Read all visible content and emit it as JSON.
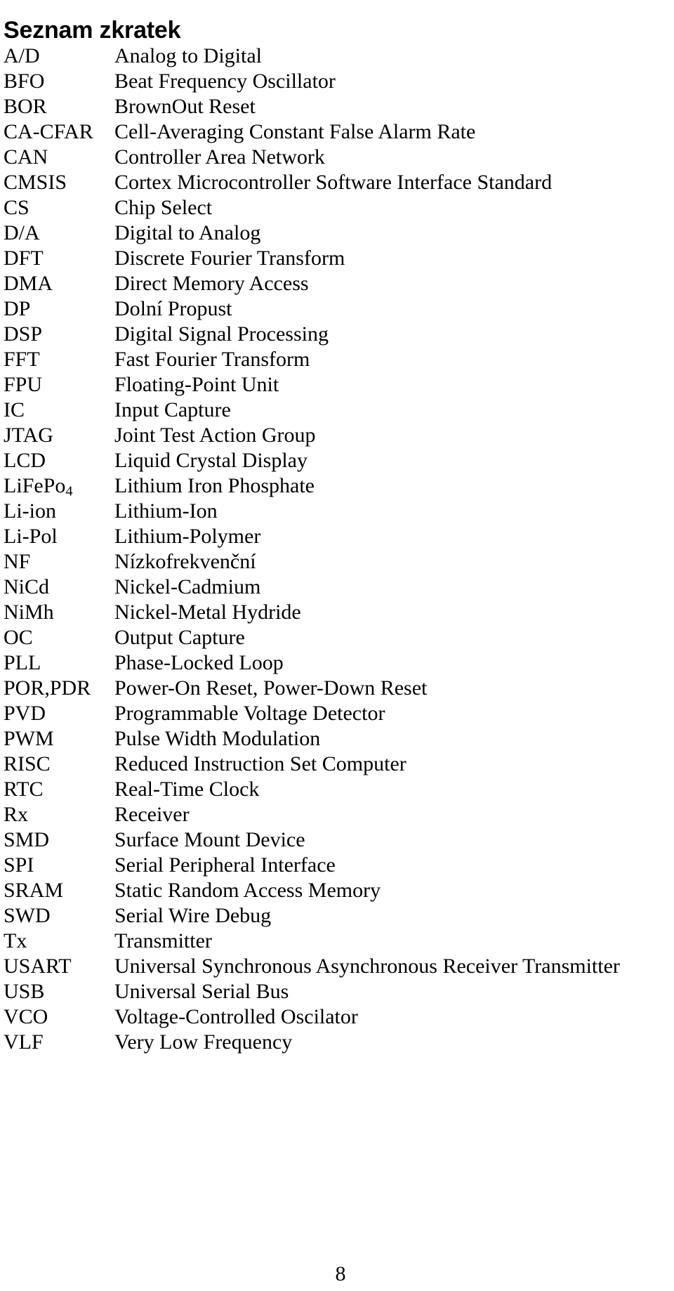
{
  "document": {
    "title": "Seznam zkratek",
    "page_number": "8"
  },
  "abbreviations": [
    {
      "term": "A/D",
      "definition": "Analog to Digital"
    },
    {
      "term": "BFO",
      "definition": "Beat Frequency Oscillator"
    },
    {
      "term": "BOR",
      "definition": "BrownOut Reset"
    },
    {
      "term": "CA-CFAR",
      "definition": "Cell-Averaging Constant False Alarm Rate"
    },
    {
      "term": "CAN",
      "definition": "Controller Area Network"
    },
    {
      "term": "CMSIS",
      "definition": "Cortex Microcontroller Software Interface Standard"
    },
    {
      "term": "CS",
      "definition": "Chip Select"
    },
    {
      "term": "D/A",
      "definition": "Digital to Analog"
    },
    {
      "term": "DFT",
      "definition": "Discrete Fourier Transform"
    },
    {
      "term": "DMA",
      "definition": "Direct Memory Access"
    },
    {
      "term": "DP",
      "definition": "Dolní Propust"
    },
    {
      "term": "DSP",
      "definition": "Digital Signal Processing"
    },
    {
      "term": "FFT",
      "definition": "Fast Fourier Transform"
    },
    {
      "term": "FPU",
      "definition": "Floating-Point Unit"
    },
    {
      "term": "IC",
      "definition": "Input Capture"
    },
    {
      "term": "JTAG",
      "definition": "Joint Test Action Group"
    },
    {
      "term": "LCD",
      "definition": "Liquid Crystal Display"
    },
    {
      "term": "LiFePo",
      "term_subscript": "4",
      "definition": "Lithium Iron Phosphate"
    },
    {
      "term": "Li-ion",
      "definition": "Lithium-Ion"
    },
    {
      "term": "Li-Pol",
      "definition": "Lithium-Polymer"
    },
    {
      "term": "NF",
      "definition": "Nízkofrekvenční"
    },
    {
      "term": "NiCd",
      "definition": "Nickel-Cadmium"
    },
    {
      "term": "NiMh",
      "definition": "Nickel-Metal Hydride"
    },
    {
      "term": "OC",
      "definition": "Output Capture"
    },
    {
      "term": "PLL",
      "definition": "Phase-Locked Loop"
    },
    {
      "term": "POR,PDR",
      "definition": "Power-On Reset, Power-Down Reset"
    },
    {
      "term": "PVD",
      "definition": "Programmable Voltage Detector"
    },
    {
      "term": "PWM",
      "definition": "Pulse Width Modulation"
    },
    {
      "term": "RISC",
      "definition": "Reduced Instruction Set Computer"
    },
    {
      "term": "RTC",
      "definition": "Real-Time Clock"
    },
    {
      "term": "Rx",
      "definition": "Receiver"
    },
    {
      "term": "SMD",
      "definition": "Surface Mount Device"
    },
    {
      "term": "SPI",
      "definition": "Serial Peripheral Interface"
    },
    {
      "term": "SRAM",
      "definition": "Static Random Access Memory"
    },
    {
      "term": "SWD",
      "definition": "Serial Wire Debug"
    },
    {
      "term": "Tx",
      "definition": "Transmitter"
    },
    {
      "term": "USART",
      "definition": "Universal Synchronous Asynchronous Receiver Transmitter"
    },
    {
      "term": "USB",
      "definition": "Universal Serial Bus"
    },
    {
      "term": "VCO",
      "definition": "Voltage-Controlled Oscilator"
    },
    {
      "term": "VLF",
      "definition": "Very Low Frequency"
    }
  ]
}
